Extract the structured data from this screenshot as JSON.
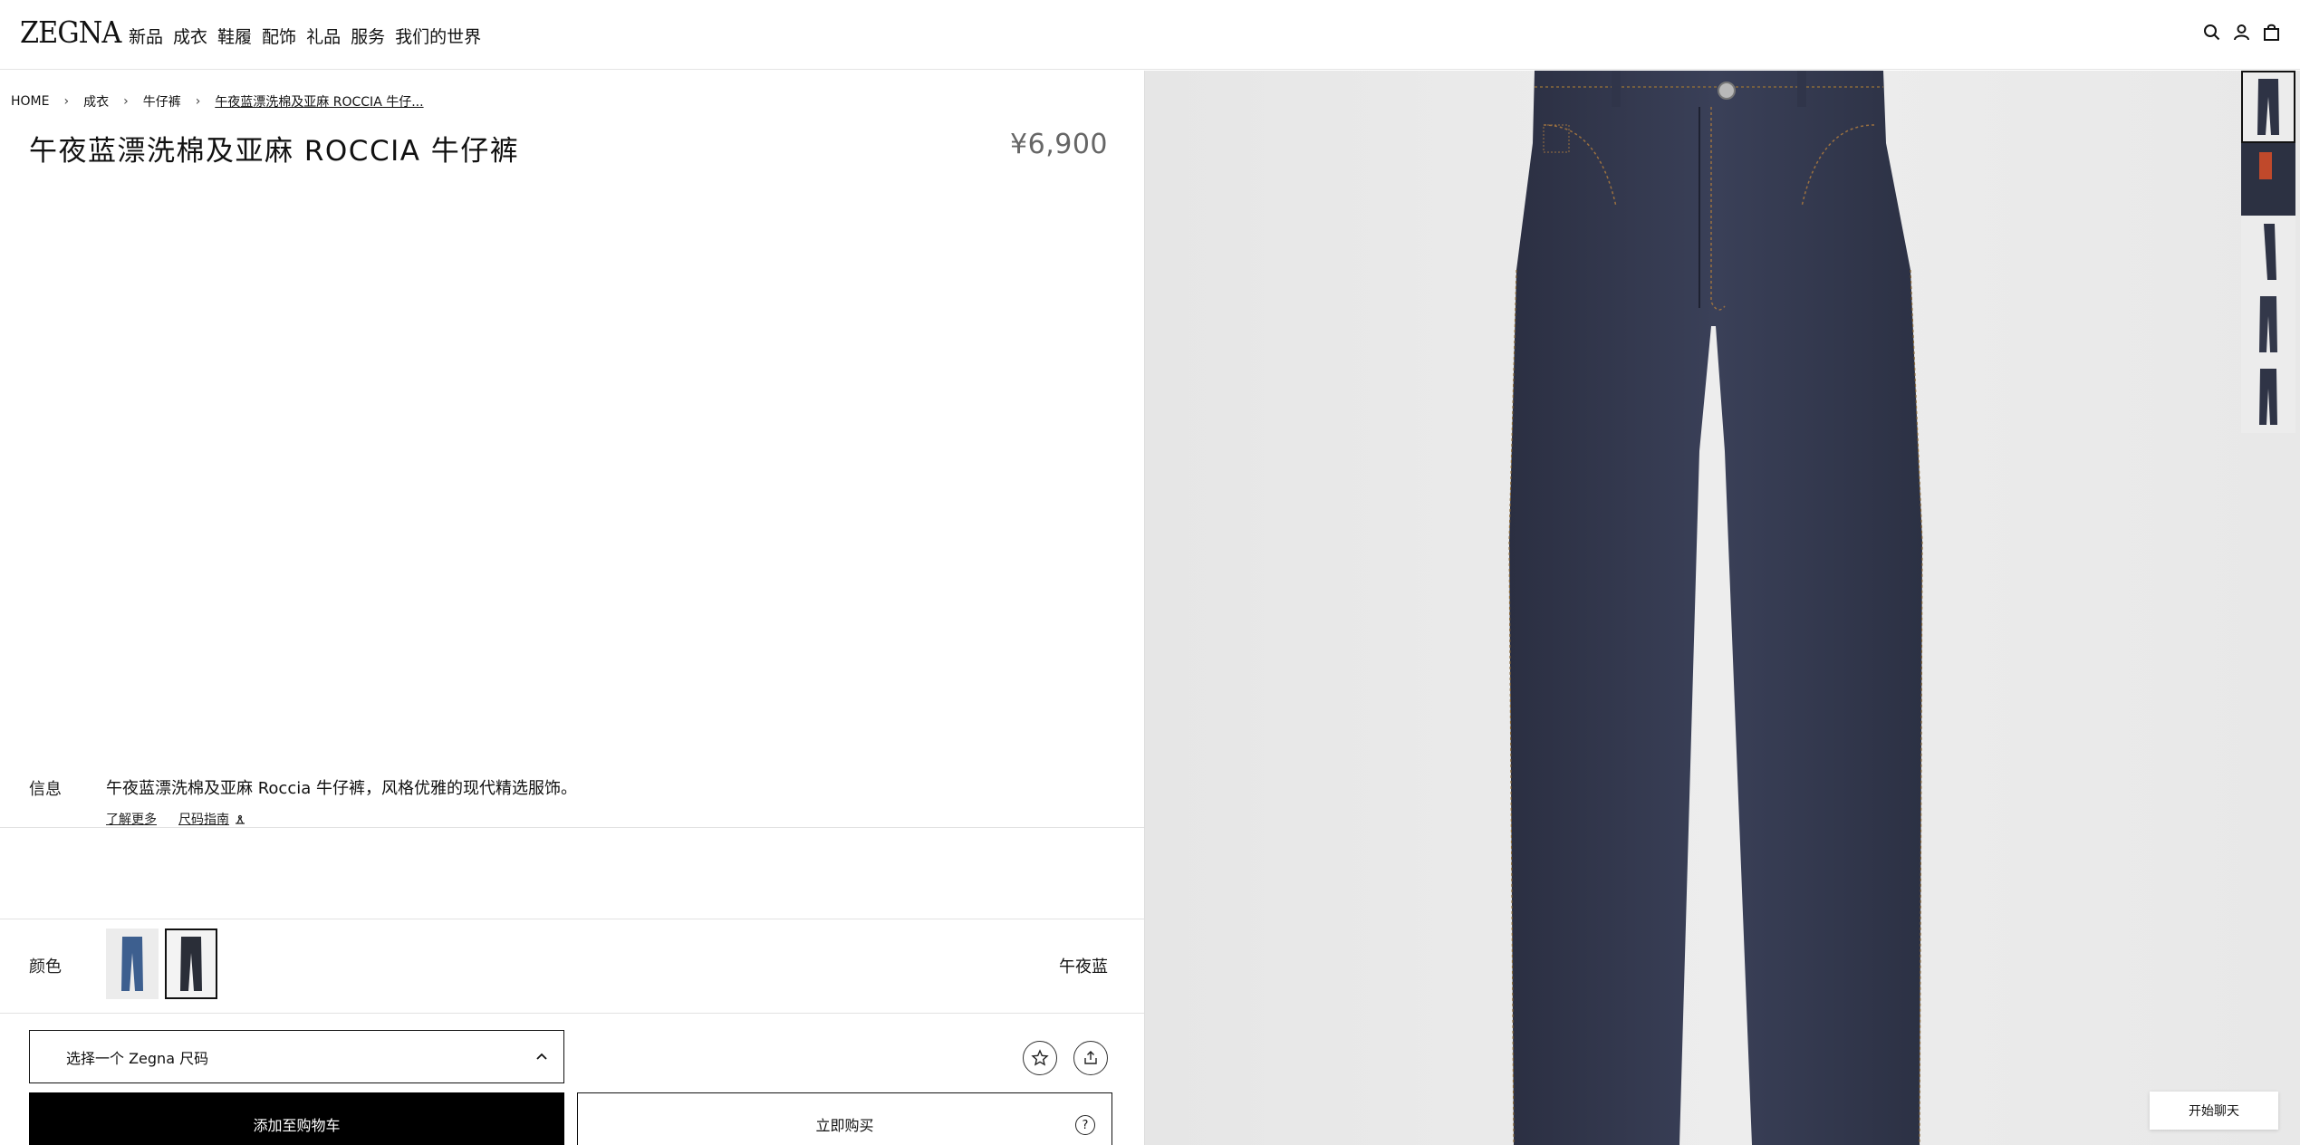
{
  "header": {
    "logo": "ZEGNA",
    "nav": [
      "新品",
      "成衣",
      "鞋履",
      "配饰",
      "礼品",
      "服务",
      "我们的世界"
    ],
    "icons": [
      "search-icon",
      "account-icon",
      "bag-icon"
    ]
  },
  "breadcrumb": [
    "HOME",
    "成衣",
    "牛仔裤",
    "午夜蓝漂洗棉及亚麻 ROCCIA 牛仔..."
  ],
  "product": {
    "title": "午夜蓝漂洗棉及亚麻 ROCCIA 牛仔裤",
    "price": "¥6,900"
  },
  "info": {
    "label": "信息",
    "text": "午夜蓝漂洗棉及亚麻 Roccia 牛仔裤，风格优雅的现代精选服饰。",
    "learn_more": "了解更多",
    "size_guide": "尺码指南"
  },
  "color": {
    "label": "颜色",
    "selected_name": "午夜蓝",
    "swatch_colors": [
      "#3b5d8c",
      "#2b2f3a"
    ]
  },
  "size_select": {
    "placeholder": "选择一个 Zegna 尺码"
  },
  "actions": {
    "add_to_cart": "添加至购物车",
    "buy_now": "立即购买",
    "help": "?"
  },
  "chat": {
    "label": "开始聊天"
  },
  "colors": {
    "denim": "#2f3447",
    "background": "#e9e9e9",
    "text": "#111111"
  }
}
